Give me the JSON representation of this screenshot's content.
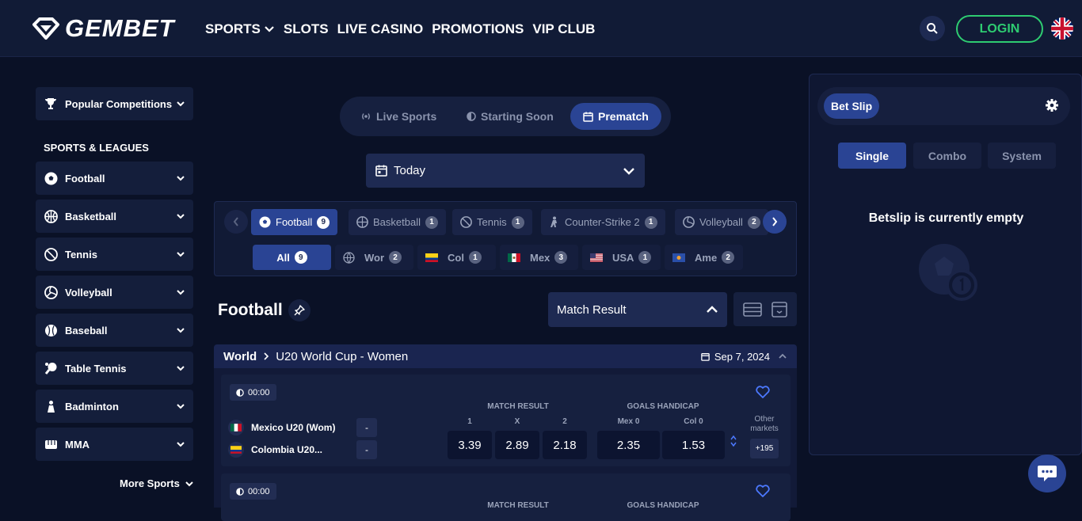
{
  "header": {
    "logo_text": "GEMBET",
    "nav": [
      {
        "label": "SPORTS",
        "has_dropdown": true
      },
      {
        "label": "SLOTS"
      },
      {
        "label": "LIVE CASINO"
      },
      {
        "label": "PROMOTIONS"
      },
      {
        "label": "VIP CLUB"
      }
    ],
    "login_label": "LOGIN",
    "language_icon": "uk-flag-icon"
  },
  "sidebar": {
    "popular_label": "Popular Competitions",
    "section_title": "SPORTS & LEAGUES",
    "items": [
      {
        "label": "Football",
        "icon": "football-icon"
      },
      {
        "label": "Basketball",
        "icon": "basketball-icon"
      },
      {
        "label": "Tennis",
        "icon": "tennis-icon"
      },
      {
        "label": "Volleyball",
        "icon": "volleyball-icon"
      },
      {
        "label": "Baseball",
        "icon": "baseball-icon"
      },
      {
        "label": "Table Tennis",
        "icon": "table-tennis-icon"
      },
      {
        "label": "Badminton",
        "icon": "badminton-icon"
      },
      {
        "label": "MMA",
        "icon": "mma-icon"
      }
    ],
    "more_sports_label": "More Sports"
  },
  "modes": {
    "live": "Live Sports",
    "soon": "Starting Soon",
    "prematch": "Prematch",
    "active": "prematch"
  },
  "date_filter": {
    "value": "Today"
  },
  "sport_tabs": [
    {
      "label": "Football",
      "count": "9"
    },
    {
      "label": "Basketball",
      "count": "1"
    },
    {
      "label": "Tennis",
      "count": "1"
    },
    {
      "label": "Counter-Strike 2",
      "count": "1"
    },
    {
      "label": "Volleyball",
      "count": "2"
    }
  ],
  "region_tabs": [
    {
      "label": "All",
      "count": "9"
    },
    {
      "label": "Wor",
      "count": "2"
    },
    {
      "label": "Col",
      "count": "1"
    },
    {
      "label": "Mex",
      "count": "3"
    },
    {
      "label": "USA",
      "count": "1"
    },
    {
      "label": "Ame",
      "count": "2"
    }
  ],
  "section": {
    "title": "Football",
    "market_select": "Match Result"
  },
  "league": {
    "region": "World",
    "name": "U20 World Cup - Women",
    "date": "Sep 7, 2024"
  },
  "matches": [
    {
      "time": "00:00",
      "home": "Mexico U20 (Wom)",
      "away": "Colombia U20...",
      "home_score": "-",
      "away_score": "-",
      "market1_title": "MATCH RESULT",
      "market1_labels": [
        "1",
        "X",
        "2"
      ],
      "market1_odds": [
        "3.39",
        "2.89",
        "2.18"
      ],
      "market2_title": "GOALS HANDICAP",
      "market2_labels": [
        "Mex 0",
        "Col 0"
      ],
      "market2_odds": [
        "2.35",
        "1.53"
      ],
      "other_label": "Other markets",
      "other_count": "+195"
    },
    {
      "time": "00:00",
      "market1_title": "MATCH RESULT",
      "market2_title": "GOALS HANDICAP"
    }
  ],
  "betslip": {
    "title": "Bet Slip",
    "tabs": [
      "Single",
      "Combo",
      "System"
    ],
    "active_tab": "Single",
    "empty_text": "Betslip is currently empty"
  },
  "colors": {
    "background": "#0a1126",
    "header": "#111b36",
    "accent": "#2a4494",
    "login_green": "#2ecc71",
    "heart_blue": "#4c79ff"
  }
}
